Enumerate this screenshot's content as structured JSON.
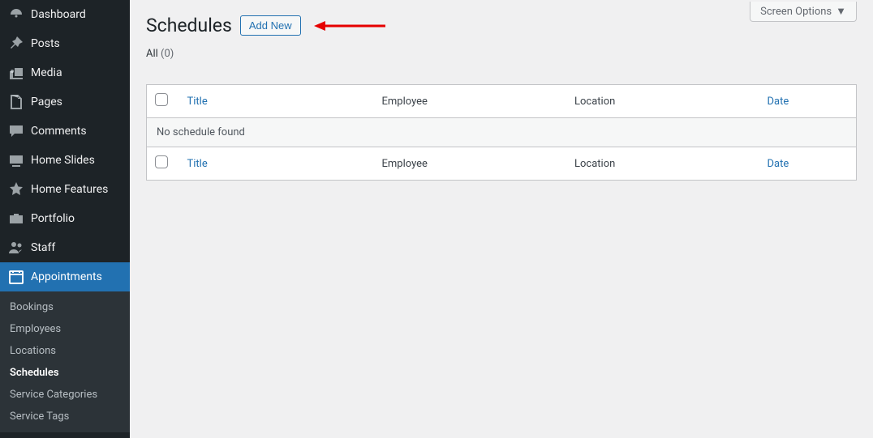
{
  "screenOptions": {
    "label": "Screen Options"
  },
  "sidebar": {
    "items": [
      {
        "label": "Dashboard",
        "icon": "dashboard"
      },
      {
        "label": "Posts",
        "icon": "pin"
      },
      {
        "label": "Media",
        "icon": "media"
      },
      {
        "label": "Pages",
        "icon": "pages"
      },
      {
        "label": "Comments",
        "icon": "comments"
      },
      {
        "label": "Home Slides",
        "icon": "slides"
      },
      {
        "label": "Home Features",
        "icon": "star"
      },
      {
        "label": "Portfolio",
        "icon": "portfolio"
      },
      {
        "label": "Staff",
        "icon": "staff"
      },
      {
        "label": "Appointments",
        "icon": "calendar",
        "active": true
      }
    ],
    "submenu": [
      {
        "label": "Bookings"
      },
      {
        "label": "Employees"
      },
      {
        "label": "Locations"
      },
      {
        "label": "Schedules",
        "current": true
      },
      {
        "label": "Service Categories"
      },
      {
        "label": "Service Tags"
      }
    ]
  },
  "page": {
    "title": "Schedules",
    "addNew": "Add New",
    "filter": {
      "label": "All",
      "count": "(0)"
    }
  },
  "table": {
    "columns": {
      "title": "Title",
      "employee": "Employee",
      "location": "Location",
      "date": "Date"
    },
    "emptyMessage": "No schedule found"
  }
}
